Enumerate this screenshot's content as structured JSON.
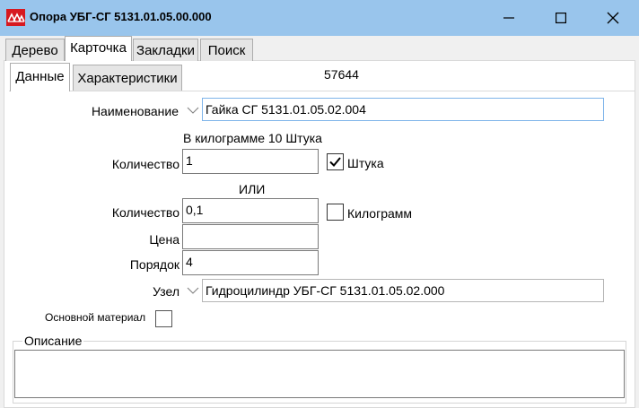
{
  "window": {
    "title": "Опора УБГ-СГ 5131.01.05.00.000",
    "logo_icon": "app-logo-icon",
    "controls": [
      "minimize-icon",
      "maximize-icon",
      "close-icon"
    ]
  },
  "tabs": [
    {
      "label": "Дерево",
      "active": false
    },
    {
      "label": "Карточка",
      "active": true
    },
    {
      "label": "Закладки",
      "active": false
    },
    {
      "label": "Поиск",
      "active": false
    }
  ],
  "subtabs": [
    {
      "label": "Данные",
      "active": true
    },
    {
      "label": "Характеристики",
      "active": false
    }
  ],
  "record_id": "57644",
  "form": {
    "name_label": "Наименование",
    "name_value": "Гайка СГ 5131.01.05.02.004",
    "per_kg_note": "В килограмме 10 Штука",
    "qty1_label": "Количество",
    "qty1_value": "1",
    "unit_pieces_label": "Штука",
    "unit_pieces_checked": true,
    "or_label": "ИЛИ",
    "qty2_label": "Количество",
    "qty2_value": "0,1",
    "unit_kg_label": "Килограмм",
    "unit_kg_checked": false,
    "price_label": "Цена",
    "price_value": "",
    "order_label": "Порядок",
    "order_value": "4",
    "node_label": "Узел",
    "node_value": "Гидроцилиндр УБГ-СГ 5131.01.05.02.000",
    "main_material_label": "Основной материал",
    "main_material_checked": false,
    "description_label": "Описание",
    "description_value": ""
  },
  "colors": {
    "titlebar": "#99c5ec",
    "logo": "#d71920",
    "window_bg": "#f0f0f0",
    "focus_border": "#7eb4ea"
  }
}
